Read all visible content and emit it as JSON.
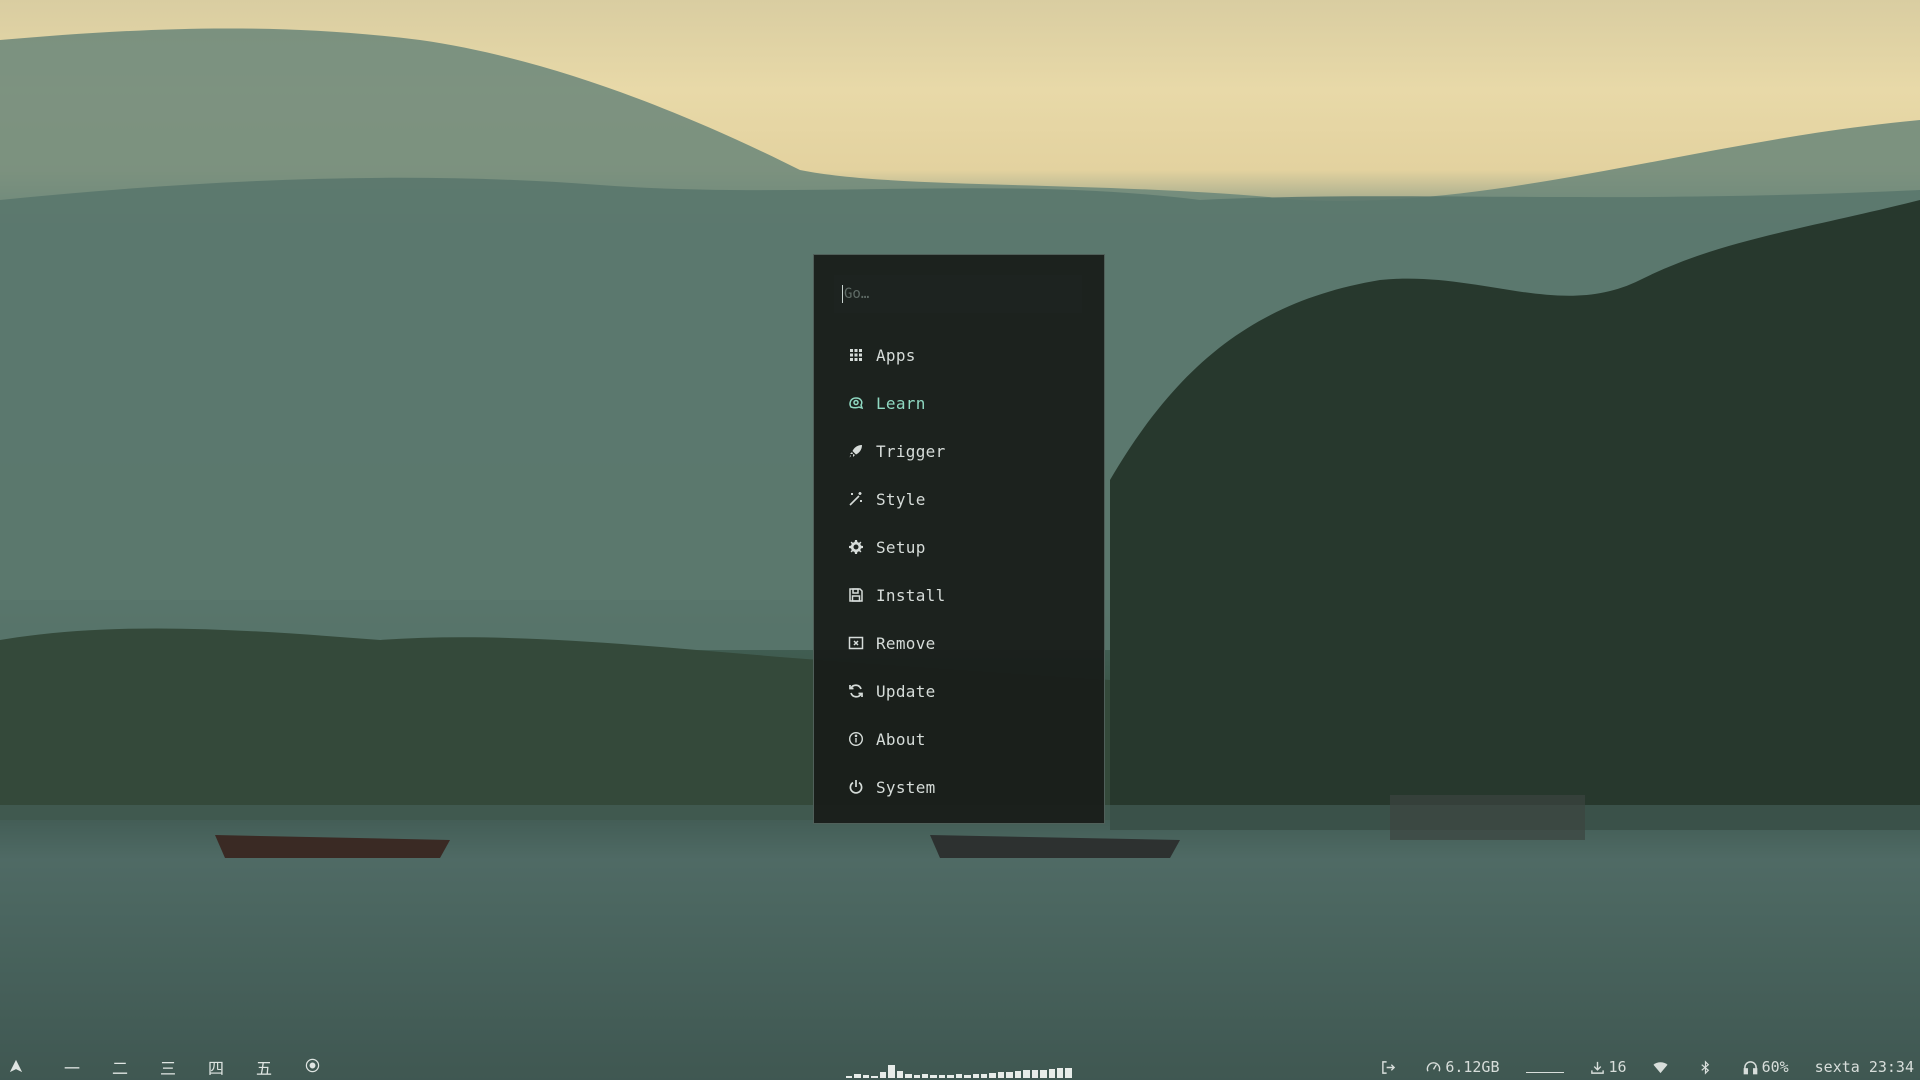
{
  "launcher": {
    "search_placeholder": "Go…",
    "items": [
      {
        "label": "Apps",
        "icon": "grid-icon",
        "active": false
      },
      {
        "label": "Learn",
        "icon": "brain-icon",
        "active": true
      },
      {
        "label": "Trigger",
        "icon": "rocket-icon",
        "active": false
      },
      {
        "label": "Style",
        "icon": "magic-wand-icon",
        "active": false
      },
      {
        "label": "Setup",
        "icon": "gear-icon",
        "active": false
      },
      {
        "label": "Install",
        "icon": "save-icon",
        "active": false
      },
      {
        "label": "Remove",
        "icon": "remove-box-icon",
        "active": false
      },
      {
        "label": "Update",
        "icon": "refresh-icon",
        "active": false
      },
      {
        "label": "About",
        "icon": "info-icon",
        "active": false
      },
      {
        "label": "System",
        "icon": "power-icon",
        "active": false
      }
    ]
  },
  "taskbar": {
    "workspaces": [
      "一",
      "二",
      "三",
      "四",
      "五"
    ],
    "status": {
      "memory": "6.12GB",
      "downloads": "16",
      "volume": "60%",
      "datetime": "sexta 23:34"
    },
    "visualizer_levels": [
      0.15,
      0.3,
      0.2,
      0.1,
      0.45,
      0.9,
      0.5,
      0.25,
      0.2,
      0.25,
      0.2,
      0.2,
      0.2,
      0.25,
      0.2,
      0.25,
      0.3,
      0.35,
      0.4,
      0.45,
      0.5,
      0.55,
      0.6,
      0.6,
      0.65,
      0.7,
      0.7
    ]
  },
  "colors": {
    "accent": "#8fd9c2",
    "text": "#d6dcd9",
    "panel": "#181d1a"
  }
}
